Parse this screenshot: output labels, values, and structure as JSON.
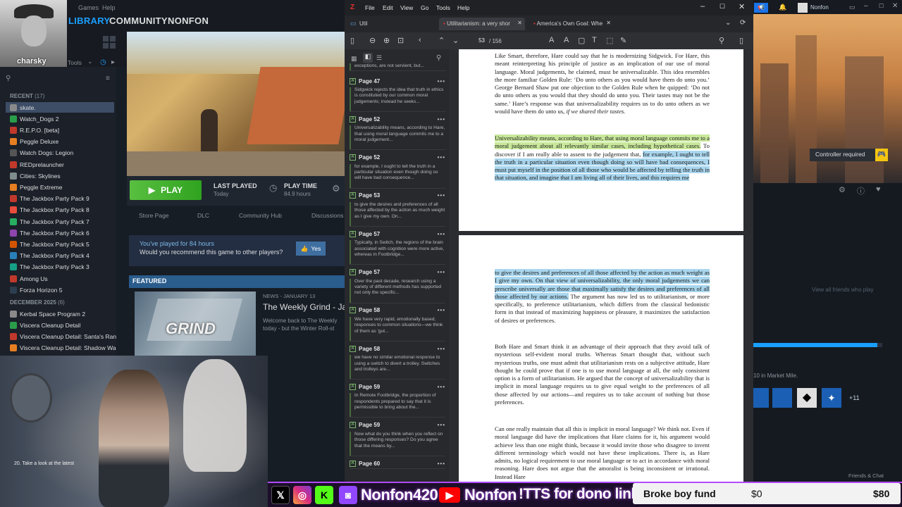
{
  "steam": {
    "menu": [
      "Games",
      "Help"
    ],
    "nav": [
      "LIBRARY",
      "COMMUNITY",
      "NONFON"
    ],
    "username": "charsky",
    "tools_label": "Tools",
    "recent_label": "RECENT",
    "recent_count": "(17)",
    "games_recent": [
      "skate.",
      "Watch_Dogs 2",
      "R.E.P.O. [beta]",
      "Peggle Deluxe",
      "Watch Dogs: Legion",
      "REDprelauncher",
      "Cities: Skylines",
      "Peggle Extreme",
      "The Jackbox Party Pack 9",
      "The Jackbox Party Pack 8",
      "The Jackbox Party Pack 7",
      "The Jackbox Party Pack 6",
      "The Jackbox Party Pack 5",
      "The Jackbox Party Pack 4",
      "The Jackbox Party Pack 3",
      "Among Us",
      "Forza Horizon 5"
    ],
    "dec_label": "DECEMBER 2025",
    "dec_count": "(6)",
    "games_dec": [
      "Kerbal Space Program 2",
      "Viscera Cleanup Detail",
      "Viscera Cleanup Detail: Santa's Ran",
      "Viscera Cleanup Detail: Shadow Wa"
    ],
    "play_label": "PLAY",
    "last_played_label": "LAST PLAYED",
    "last_played_value": "Today",
    "play_time_label": "PLAY TIME",
    "play_time_value": "84.9 hours",
    "subnav": [
      "Store Page",
      "DLC",
      "Community Hub",
      "Discussions"
    ],
    "review_title": "You've played for 84 hours",
    "review_question": "Would you recommend this game to other players?",
    "review_yes": "Yes",
    "featured_label": "FEATURED",
    "news_meta": "NEWS - JANUARY 13",
    "news_title": "The Weekly Grind - Ja",
    "news_body": "Welcome back to The Weekly today - but the Winter Roll-st",
    "news_img_text": "GRIND",
    "bottom_text": "20. Take a look at the latest"
  },
  "pdf": {
    "menu": [
      "File",
      "Edit",
      "View",
      "Go",
      "Tools",
      "Help"
    ],
    "util_tab": "Util",
    "tabs": [
      "Utilitarianism: a very shor",
      "America's Own Goal: Whe"
    ],
    "page_current": "53",
    "page_total": "/ 156",
    "annotations": [
      {
        "page": "",
        "text": "exceptions, are not servient, but..."
      },
      {
        "page": "Page 47",
        "text": "Sidgwick rejects the idea that truth in ethics is constituted by our common moral judgements; instead he seeks..."
      },
      {
        "page": "Page 52",
        "text": "Universalizability means, according to Hare, that using moral language commits me to a moral judgement..."
      },
      {
        "page": "Page 52",
        "text": "for example, I ought to tell the truth in a particular situation even though doing so will have bad consequence..."
      },
      {
        "page": "Page 53",
        "text": "to give the desires and preferences of all those affected by the action as much weight as I give my own. On..."
      },
      {
        "page": "Page 57",
        "text": "Typically, in Switch, the regions of the brain associated with cognition were more active, whereas in Footbridge..."
      },
      {
        "page": "Page 57",
        "text": "Over the past decade, research using a variety of different methods has supported not only the specific..."
      },
      {
        "page": "Page 58",
        "text": "We have very rapid, emotionally based, responses to common situations—we think of them as 'gut..."
      },
      {
        "page": "Page 58",
        "text": "we have no similar emotional response to using a switch to divert a trolley. Switches and trolleys are..."
      },
      {
        "page": "Page 59",
        "text": "In Remote Footbridge, the proportion of respondents prepared to say that it is permissible to bring about the..."
      },
      {
        "page": "Page 59",
        "text": "Now what do you think when you reflect on those differing responses? Do you agree that the means by..."
      },
      {
        "page": "Page 60",
        "text": ""
      }
    ],
    "page1_para1_a": "Like Smart, therefore, Hare could say that he is modernizing Sidgwick. For Hare, this meant reinterpreting his principle of justice as an implication of our use of moral language. Moral judgements, he claimed, must be universalizable. This idea resembles the more familiar Golden Rule: ‘Do unto others as you would have them do unto you.’ George Bernard Shaw put one objection to the Golden Rule when he quipped: ‘Do not do unto others as you would that they should do unto you. Their tastes may not be the same.’ Hare’s response was that universalizability requires us to do unto others as we would have them do unto us, ",
    "page1_para1_b": "if we shared their tastes.",
    "page1_hl_green": "Universalizability means, according to Hare, that using moral language commits me to a moral judgement about all relevantly similar cases, including hypothetical cases.",
    "page1_plain": " To discover if I am really able to assent to the judgement that, ",
    "page1_hl_blue": "for example, I ought to tell the truth in a particular situation even though doing so will have bad consequences, I must put myself in the position of all those who would be affected by telling the truth in that situation, and imagine that I am living all of their lives, and this requires me",
    "page2_hl_blue": "to give the desires and preferences of all those affected by the action as much weight as I give my own. On that view of universalizability, the only moral judgements we can prescribe universally are those that maximally satisfy the desires and preferences of all those affected by our actions.",
    "page2_rest": " The argument has now led us to utilitarianism, or more specifically, to preference utilitarianism, which differs from the classical hedonistic form in that instead of maximizing happiness or pleasure, it maximizes the satisfaction of desires or preferences.",
    "page2_para2": "Both Hare and Smart think it an advantage of their approach that they avoid talk of mysterious self-evident moral truths. Whereas Smart thought that, without such mysterious truths, one must admit that utilitarianism rests on a subjective attitude, Hare thought he could prove that if one is to use moral language at all, the only consistent option is a form of utilitarianism. He argued that the concept of universalizability that is implicit in moral language requires us to give equal weight to the preferences of all those affected by our actions—and requires us to take account of nothing but those preferences.",
    "page2_para3": "Can one really maintain that all this is implicit in moral language? We think not. Even if moral language did have the implications that Hare claims for it, his argument would achieve less than one might think, because it would invite those who disagree to invent different terminology which would not have these implications. There is, as Hare admits, no logical requirement to use moral language or to act in accordance with moral reasoning. Hare does not argue that the amoralist is being inconsistent or irrational. Instead Hare"
  },
  "right": {
    "user": "Nonfon",
    "controller_required": "Controller required",
    "view_all_friends": "View all friends who play",
    "market_text": "10 in Market Mile.",
    "plus_count": "+11",
    "friends_chat": "Friends & Chat"
  },
  "overlay": {
    "handle1": "Nonfon420",
    "handle2": "Nonfon",
    "tts": "!TTS for dono link",
    "fund_label": "Broke boy fund",
    "fund_current": "$0",
    "fund_goal": "$80"
  }
}
